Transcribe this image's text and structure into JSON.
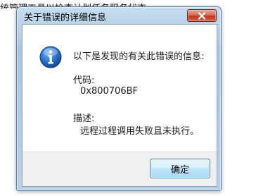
{
  "background": {
    "text": "统管理工具以检查计划任务服务状态"
  },
  "dialog": {
    "title": "关于错误的详细信息",
    "close_icon": "close-icon",
    "message_icon": "info-icon",
    "heading": "以下是发现的有关此错误的信息:",
    "code_label": "代码:",
    "code_value": "0x800706BF",
    "description_label": "描述:",
    "description_value": "远程过程调用失败且未执行。",
    "ok_label": "确定"
  },
  "colors": {
    "close_button": "#c2371f",
    "info_icon": "#1d5fb4",
    "title_bar": "#bdd5eb"
  }
}
